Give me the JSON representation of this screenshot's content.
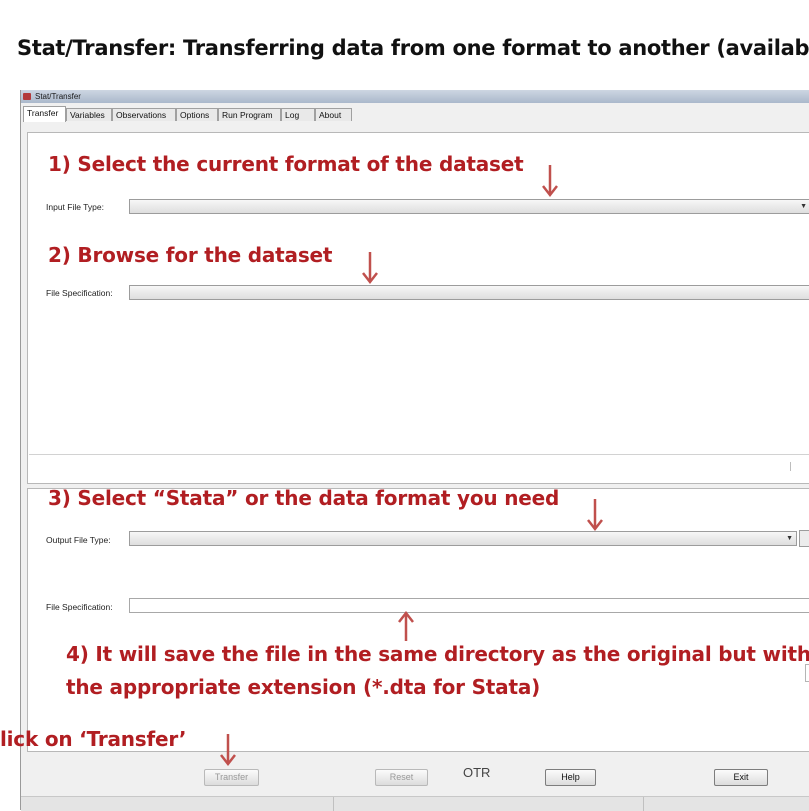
{
  "slide": {
    "title": "Stat/Transfer: Transferring data from one format to another (available i"
  },
  "window": {
    "title": "Stat/Transfer",
    "tabs": [
      "Transfer",
      "Variables",
      "Observations",
      "Options",
      "Run Program",
      "Log",
      "About"
    ],
    "active_tab": "Transfer"
  },
  "input": {
    "file_type_label": "Input File Type:",
    "file_type_value": "",
    "file_spec_label": "File Specification:",
    "file_spec_value": ""
  },
  "output": {
    "file_type_label": "Output File Type:",
    "file_type_value": "",
    "file_spec_label": "File Specification:",
    "file_spec_value": ""
  },
  "annotations": {
    "step1": "1) Select the current format of the dataset",
    "step2": "2) Browse for the dataset",
    "step3": "3) Select “Stata” or the data format you need",
    "step4_line1": "4) It will save the file in the same directory as the original but with",
    "step4_line2": "the appropriate extension (*.dta for Stata)",
    "step5": "lick on ‘Transfer’"
  },
  "buttons": {
    "transfer": "Transfer",
    "reset": "Reset",
    "help": "Help",
    "exit": "Exit"
  },
  "otr_label": "OTR",
  "colors": {
    "annotation": "#b11e22",
    "arrow": "#c0504d"
  }
}
